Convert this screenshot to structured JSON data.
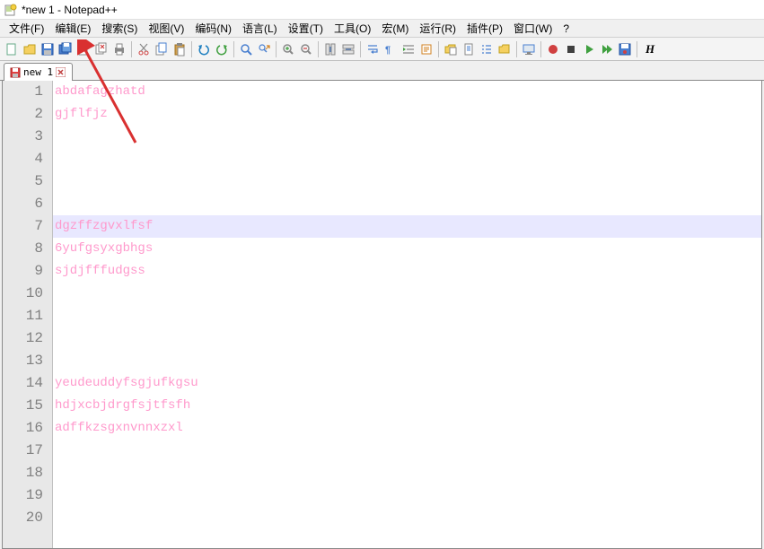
{
  "title": "*new 1 - Notepad++",
  "menus": [
    "文件(F)",
    "编辑(E)",
    "搜索(S)",
    "视图(V)",
    "编码(N)",
    "语言(L)",
    "设置(T)",
    "工具(O)",
    "宏(M)",
    "运行(R)",
    "插件(P)",
    "窗口(W)",
    "?"
  ],
  "tab": {
    "label": "new 1",
    "modified": true
  },
  "lines": [
    {
      "num": "1",
      "text": "abdafagzhatd",
      "hl": false
    },
    {
      "num": "2",
      "text": "gjflfjz",
      "hl": false
    },
    {
      "num": "3",
      "text": "",
      "hl": false
    },
    {
      "num": "4",
      "text": "",
      "hl": false
    },
    {
      "num": "5",
      "text": "",
      "hl": false
    },
    {
      "num": "6",
      "text": "",
      "hl": false
    },
    {
      "num": "7",
      "text": "dgzffzgvxlfsf",
      "hl": true
    },
    {
      "num": "8",
      "text": "6yufgsyxgbhgs",
      "hl": false
    },
    {
      "num": "9",
      "text": "sjdjfffudgss",
      "hl": false
    },
    {
      "num": "10",
      "text": "",
      "hl": false
    },
    {
      "num": "11",
      "text": "",
      "hl": false
    },
    {
      "num": "12",
      "text": "",
      "hl": false
    },
    {
      "num": "13",
      "text": "",
      "hl": false
    },
    {
      "num": "14",
      "text": "yeudeuddyfsgjufkgsu",
      "hl": false
    },
    {
      "num": "15",
      "text": "hdjxcbjdrgfsjtfsfh",
      "hl": false
    },
    {
      "num": "16",
      "text": "adffkzsgxnvnnxzxl",
      "hl": false
    },
    {
      "num": "17",
      "text": "",
      "hl": false
    },
    {
      "num": "18",
      "text": "",
      "hl": false
    },
    {
      "num": "19",
      "text": "",
      "hl": false
    },
    {
      "num": "20",
      "text": "",
      "hl": false
    }
  ],
  "toolbar_icons": [
    "new-icon",
    "open-icon",
    "save-icon",
    "saveall-icon",
    "close-icon",
    "closeall-icon",
    "print-icon",
    "sep",
    "cut-icon",
    "copy-icon",
    "paste-icon",
    "sep",
    "undo-icon",
    "redo-icon",
    "sep",
    "find-icon",
    "replace-icon",
    "sep",
    "zoomin-icon",
    "zoomout-icon",
    "sep",
    "sync-v-icon",
    "sync-h-icon",
    "sep",
    "wordwrap-icon",
    "allchars-icon",
    "indent-icon",
    "userlang-icon",
    "sep",
    "folder-map-icon",
    "doc-map-icon",
    "func-list-icon",
    "folder-ws-icon",
    "sep",
    "monitor-icon",
    "sep",
    "record-icon",
    "stop-icon",
    "play-icon",
    "playmulti-icon",
    "savemacro-icon",
    "sep",
    "h-icon"
  ]
}
